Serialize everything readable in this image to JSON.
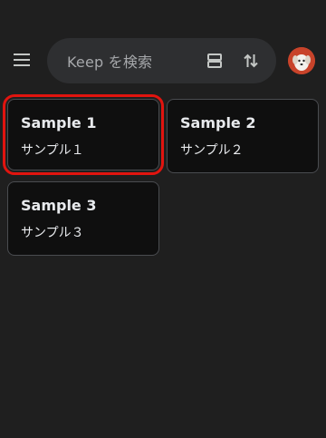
{
  "search": {
    "placeholder": "Keep を検索"
  },
  "icons": {
    "menu": "hamburger-menu-icon",
    "view": "list-view-icon",
    "sort": "sort-arrows-icon",
    "avatar": "profile-avatar"
  },
  "colors": {
    "background": "#1f1f1f",
    "search_bg": "#2e2f31",
    "card_bg": "#0f0f0f",
    "card_border": "#4a4c50",
    "selection": "#e1140f",
    "avatar": "#c8432a"
  },
  "notes": [
    {
      "title": "Sample 1",
      "body": "サンプル１",
      "selected": true
    },
    {
      "title": "Sample 2",
      "body": "サンプル２",
      "selected": false
    },
    {
      "title": "Sample 3",
      "body": "サンプル３",
      "selected": false
    }
  ]
}
